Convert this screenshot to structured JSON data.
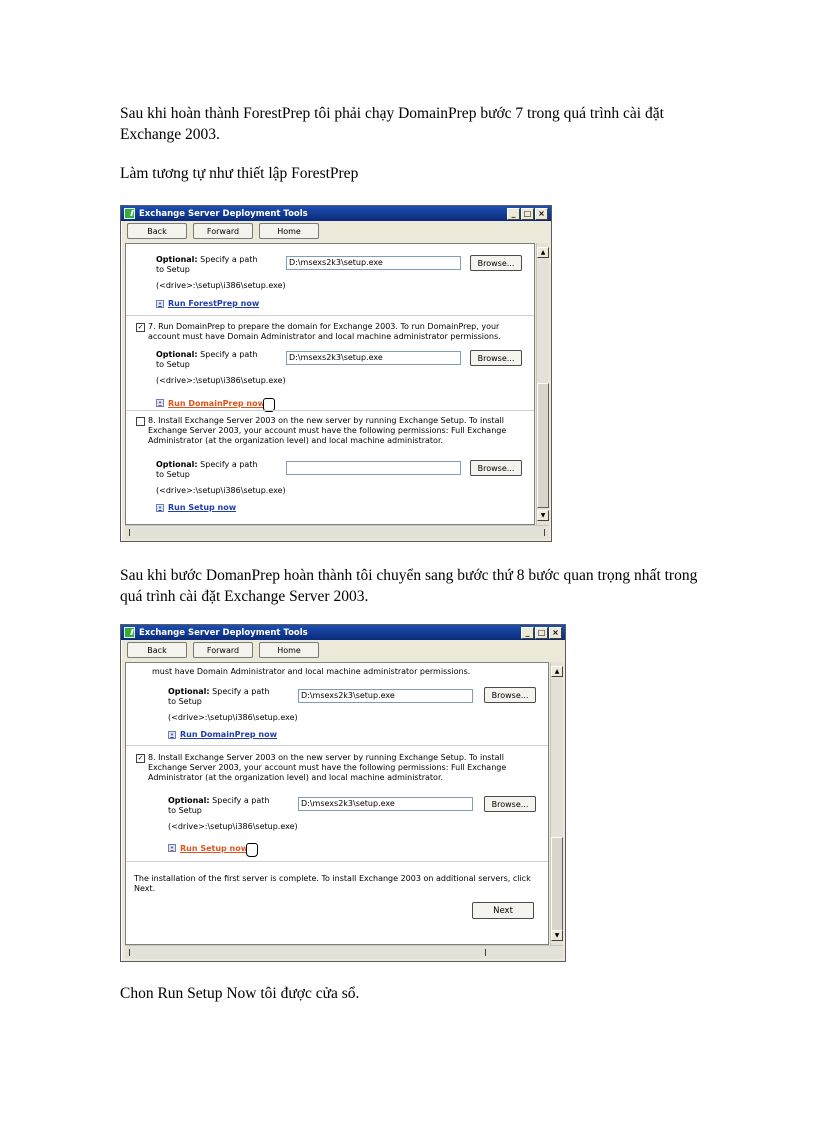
{
  "paragraphs": {
    "p1": "Sau khi hoàn thành ForestPrep tôi phải chạy DomainPrep bước 7 trong quá trình cài đặt Exchange 2003.",
    "p2": "Làm tương tự như thiết lập ForestPrep",
    "p3": "Sau khi bước DomanPrep hoàn thành tôi chuyển sang bước thứ 8 bước quan trọng nhất trong quá trình cài đặt Exchange Server 2003.",
    "p4": "Chon Run Setup Now tôi được cửa sổ."
  },
  "dialog1": {
    "title": "Exchange Server Deployment Tools",
    "nav": {
      "back": "Back",
      "forward": "Forward",
      "home": "Home"
    },
    "opt_label": "Optional:",
    "opt_text": " Specify a path to Setup",
    "opt_hint": "(<drive>:\\setup\\i386\\setup.exe)",
    "browse": "Browse...",
    "path1": "D:\\msexs2k3\\setup.exe",
    "link1": "Run ForestPrep now",
    "step7_check": "✓",
    "step7_text": "7. Run DomainPrep to prepare the domain for Exchange 2003. To run DomainPrep, your account must have Domain Administrator and local machine administrator permissions.",
    "path2": "D:\\msexs2k3\\setup.exe",
    "link2": "Run DomainPrep now",
    "step8_check": "",
    "step8_text": "8. Install Exchange Server 2003 on the new server by running Exchange Setup. To install Exchange Server 2003, your account must have the following permissions: Full Exchange Administrator (at the organization level) and local machine administrator.",
    "path3": "",
    "link3": "Run Setup now"
  },
  "dialog2": {
    "title": "Exchange Server Deployment Tools",
    "nav": {
      "back": "Back",
      "forward": "Forward",
      "home": "Home"
    },
    "top_text": "must have Domain Administrator and local machine administrator permissions.",
    "opt_label": "Optional:",
    "opt_text": " Specify a path to Setup",
    "opt_hint": "(<drive>:\\setup\\i386\\setup.exe)",
    "browse": "Browse...",
    "path1": "D:\\msexs2k3\\setup.exe",
    "link1": "Run DomainPrep now",
    "step8_check": "✓",
    "step8_text": "8. Install Exchange Server 2003 on the new server by running Exchange Setup. To install Exchange Server 2003, your account must have the following permissions: Full Exchange Administrator (at the organization level) and local machine administrator.",
    "path2": "D:\\msexs2k3\\setup.exe",
    "link2": "Run Setup now",
    "complete_text": "The installation of the first server is complete. To install Exchange 2003 on additional servers, click Next.",
    "next": "Next"
  },
  "icons": {
    "window_control": [
      "minimize-icon",
      "maximize-icon",
      "close-icon"
    ],
    "link": "link-arrow-icon",
    "cursor": "hand-cursor-icon"
  },
  "colors": {
    "titlebar": "#0a2a78",
    "link": "#1f3ea8",
    "link_active": "#e0531a",
    "window_bg": "#ece9d8"
  }
}
